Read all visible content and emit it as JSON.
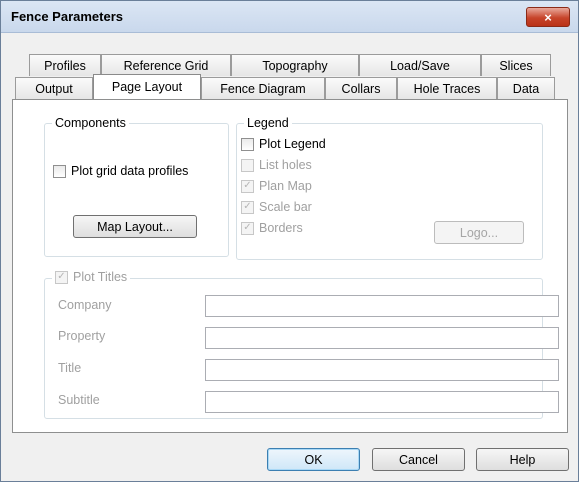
{
  "window": {
    "title": "Fence Parameters",
    "close_icon": "×"
  },
  "tabs": {
    "back": [
      "Profiles",
      "Reference Grid",
      "Topography",
      "Load/Save",
      "Slices"
    ],
    "front": [
      "Output",
      "Page Layout",
      "Fence Diagram",
      "Collars",
      "Hole Traces",
      "Data"
    ],
    "active": "Page Layout"
  },
  "components": {
    "title": "Components",
    "plot_grid_profiles": {
      "label": "Plot grid data profiles",
      "checked": false
    },
    "map_layout_button": "Map Layout..."
  },
  "legend": {
    "title": "Legend",
    "plot_legend": {
      "label": "Plot Legend",
      "checked": false
    },
    "list_holes": {
      "label": "List holes",
      "checked": false
    },
    "plan_map": {
      "label": "Plan Map",
      "checked": true
    },
    "scale_bar": {
      "label": "Scale bar",
      "checked": true
    },
    "borders": {
      "label": "Borders",
      "checked": true
    },
    "logo_button": "Logo..."
  },
  "titles": {
    "plot_titles": {
      "label": "Plot Titles",
      "checked": true
    },
    "company": {
      "label": "Company",
      "value": ""
    },
    "property": {
      "label": "Property",
      "value": ""
    },
    "title": {
      "label": "Title",
      "value": ""
    },
    "subtitle": {
      "label": "Subtitle",
      "value": ""
    }
  },
  "buttons": {
    "ok": "OK",
    "cancel": "Cancel",
    "help": "Help"
  },
  "check_glyph": "✓"
}
